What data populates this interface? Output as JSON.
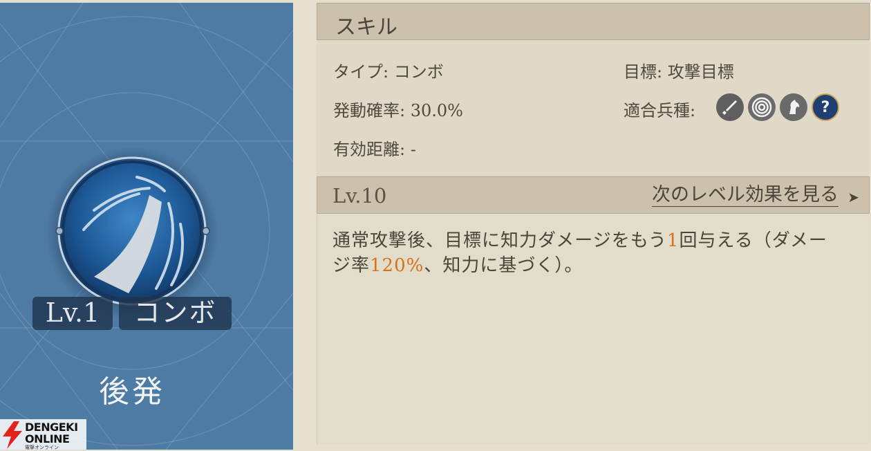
{
  "skill_card": {
    "level_badge": "Lv.1",
    "type_badge": "コンボ",
    "timing_label": "後発"
  },
  "skill_section": {
    "title": "スキル",
    "type_label": "タイプ:",
    "type_value": "コンボ",
    "target_label": "目標:",
    "target_value": "攻撃目標",
    "activation_label": "発動確率:",
    "activation_value": "30.0%",
    "troops_label": "適合兵種:",
    "range_label": "有効距離:",
    "range_value": "-",
    "troop_icons": [
      "sword-icon",
      "target-icon",
      "horse-icon",
      "question-icon"
    ]
  },
  "level_section": {
    "title": "Lv.10",
    "next_level_link": "次のレベル効果を見る",
    "description": {
      "part1": "通常攻撃後、目標に知力ダメージをもう",
      "count": "1",
      "part2": "回与える（ダメージ率",
      "rate": "120%",
      "part3": "、知力に基づく）。"
    }
  },
  "watermark": {
    "line1": "DENGEKI",
    "line2": "ONLINE",
    "sub": "電撃オンライン"
  },
  "colors": {
    "card_blue": "#4e7ba4",
    "highlight_orange": "#d8711a",
    "parchment": "#e6dfcf"
  }
}
